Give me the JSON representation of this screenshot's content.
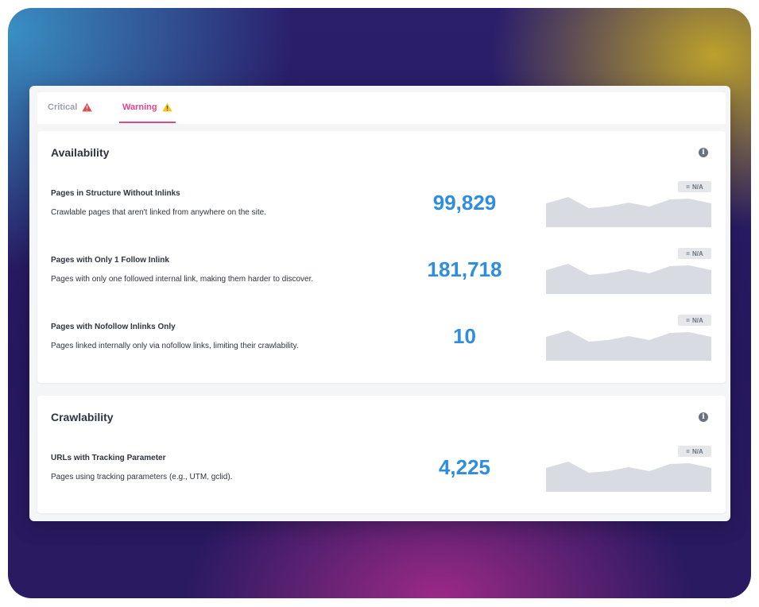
{
  "tabs": {
    "critical": "Critical",
    "warning": "Warning"
  },
  "colors": {
    "critical_icon": "#e5484d",
    "warning_icon": "#f5c518",
    "active_tab": "#e0468a",
    "metric": "#2f8ddf",
    "sparkline": "#d8dce2"
  },
  "sections": {
    "availability": {
      "title": "Availability",
      "rows": [
        {
          "title": "Pages in Structure Without Inlinks",
          "description": "Crawlable pages that aren't linked from anywhere on the site.",
          "value": "99,829",
          "badge_symbol": "=",
          "badge_text": "N/A"
        },
        {
          "title": "Pages with Only 1 Follow Inlink",
          "description": "Pages with only one followed internal link, making them harder to discover.",
          "value": "181,718",
          "badge_symbol": "=",
          "badge_text": "N/A"
        },
        {
          "title": "Pages with Nofollow Inlinks Only",
          "description": "Pages linked internally only via nofollow links, limiting their crawlability.",
          "value": "10",
          "badge_symbol": "=",
          "badge_text": "N/A"
        }
      ]
    },
    "crawlability": {
      "title": "Crawlability",
      "rows": [
        {
          "title": "URLs with Tracking Parameter",
          "description": "Pages using tracking parameters (e.g., UTM, gclid).",
          "value": "4,225",
          "badge_symbol": "=",
          "badge_text": "N/A"
        }
      ]
    }
  },
  "icons": {
    "critical": "warning-triangle-icon",
    "warning": "warning-triangle-icon",
    "info": "info-icon",
    "trend": "equals-icon"
  }
}
